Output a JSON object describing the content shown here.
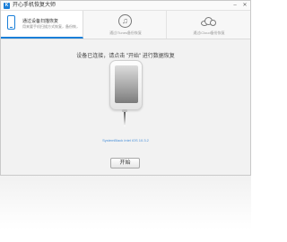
{
  "window": {
    "app_title": "开心手机恢复大师",
    "logo_letter": "K",
    "controls": [
      "minimize-icon",
      "close-icon"
    ]
  },
  "tabs": [
    {
      "title": "通过设备扫描恢复",
      "subtitle": "用来要手机扫描方式恢复，备份恢，您通过这台恢复手机数据",
      "icon": "phone-icon",
      "active": true
    },
    {
      "label": "通过iTunes备份恢复",
      "icon": "music-note-icon",
      "active": false
    },
    {
      "label": "通过iCloud备份恢复",
      "icon": "cloud-icon",
      "active": false
    }
  ],
  "main": {
    "instruction": "设备已连接，请点击 \"开始\" 进行数据恢复",
    "device_info": "SystemBlack Intel iOS 10.3.2",
    "start_label": "开始"
  },
  "colors": {
    "accent": "#1a7fd8",
    "info_text": "#4a90d9"
  }
}
